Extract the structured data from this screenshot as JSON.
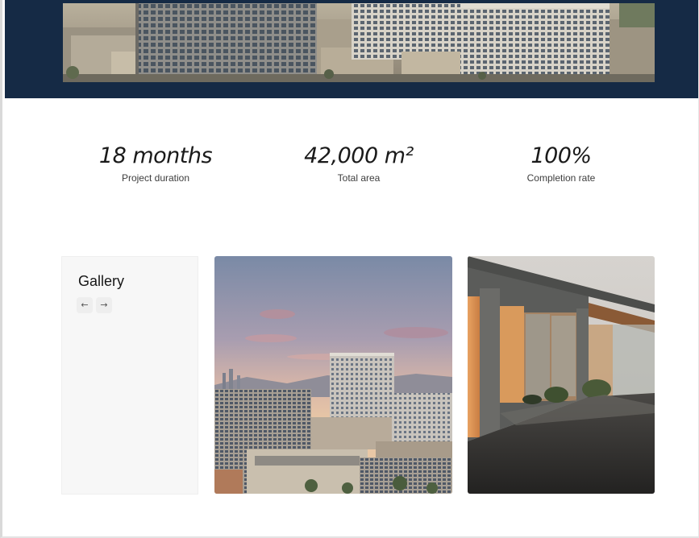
{
  "hero": {
    "image_alt": "hero-building-render"
  },
  "stats": [
    {
      "value": "18 months",
      "label": "Project duration"
    },
    {
      "value": "42,000 m²",
      "label": "Total area"
    },
    {
      "value": "100%",
      "label": "Completion rate"
    }
  ],
  "gallery": {
    "title": "Gallery",
    "prev_icon": "←",
    "next_icon": "→",
    "images": [
      "aerial-city-sunset-photo",
      "concrete-glass-pavilion-photo"
    ]
  },
  "colors": {
    "hero_background": "#152a45",
    "panel_background": "#f7f7f7",
    "text_primary": "#1a1a1a"
  }
}
